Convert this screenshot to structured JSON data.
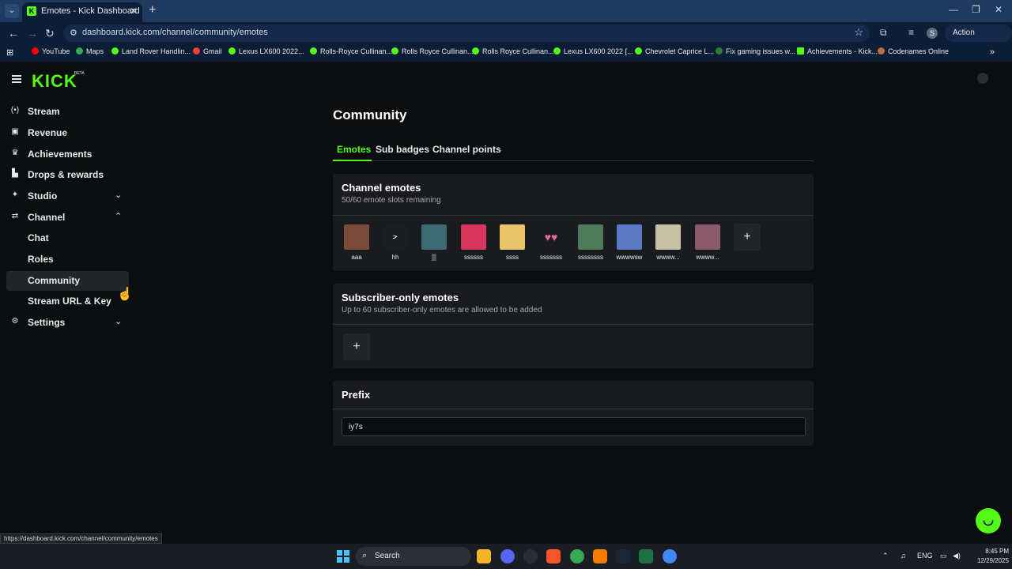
{
  "browser": {
    "tab_title": "Emotes - Kick Dashboard",
    "url": "dashboard.kick.com/channel/community/emotes",
    "profile_initial": "S",
    "action_required": "Action required",
    "status_url": "https://dashboard.kick.com/channel/community/emotes",
    "bookmarks": [
      "YouTube",
      "Maps",
      "Land Rover Handlin...",
      "Gmail",
      "Lexus LX600 2022...",
      "Rolls-Royce Cullinan...",
      "Rolls Royce Cullinan...",
      "Rolls Royce Cullinan...",
      "Lexus LX600 2022 [...",
      "Chevrolet Caprice L...",
      "Fix gaming issues w...",
      "Achievements - Kick...",
      "Codenames Online"
    ]
  },
  "app": {
    "logo": "KICK",
    "logo_beta": "BETA"
  },
  "sidebar": {
    "items": [
      {
        "label": "Stream",
        "icon": "broadcast-icon"
      },
      {
        "label": "Revenue",
        "icon": "wallet-icon"
      },
      {
        "label": "Achievements",
        "icon": "trophy-icon"
      },
      {
        "label": "Drops & rewards",
        "icon": "gift-icon"
      },
      {
        "label": "Studio",
        "icon": "studio-icon"
      },
      {
        "label": "Channel",
        "icon": "channel-icon"
      },
      {
        "label": "Chat"
      },
      {
        "label": "Roles"
      },
      {
        "label": "Community"
      },
      {
        "label": "Stream URL & Key"
      },
      {
        "label": "Settings",
        "icon": "gear-icon"
      }
    ]
  },
  "main": {
    "title": "Community",
    "tabs": [
      "Emotes",
      "Sub badges",
      "Channel points"
    ],
    "channel_emotes": {
      "title": "Channel emotes",
      "subtitle": "50/60 emote slots remaining",
      "emotes": [
        {
          "name": "aaa",
          "color": "#7a4b3a"
        },
        {
          "name": "hh",
          "color": "#1b1d20"
        },
        {
          "name": "▒",
          "color": "#3e6b73"
        },
        {
          "name": "ssssss",
          "color": "#d9365e"
        },
        {
          "name": "ssss",
          "color": "#e8c46a"
        },
        {
          "name": "sssssss",
          "color": "#e56c9a"
        },
        {
          "name": "ssssssss",
          "color": "#4f7a5a"
        },
        {
          "name": "wwwwsw",
          "color": "#5b7cc4"
        },
        {
          "name": "wwww...",
          "color": "#c9c1a6"
        },
        {
          "name": "wwww...",
          "color": "#8a5a6a"
        }
      ]
    },
    "subscriber_emotes": {
      "title": "Subscriber-only emotes",
      "subtitle": "Up to 60 subscriber-only emotes are allowed to be added"
    },
    "prefix": {
      "title": "Prefix",
      "value": "iy7s"
    }
  },
  "taskbar": {
    "search": "Search",
    "lang": "ENG",
    "time": "8:45 PM",
    "date": "12/29/2025"
  },
  "colors": {
    "accent": "#53fc18",
    "background": "#0b0d0f",
    "card": "#191b1f"
  }
}
